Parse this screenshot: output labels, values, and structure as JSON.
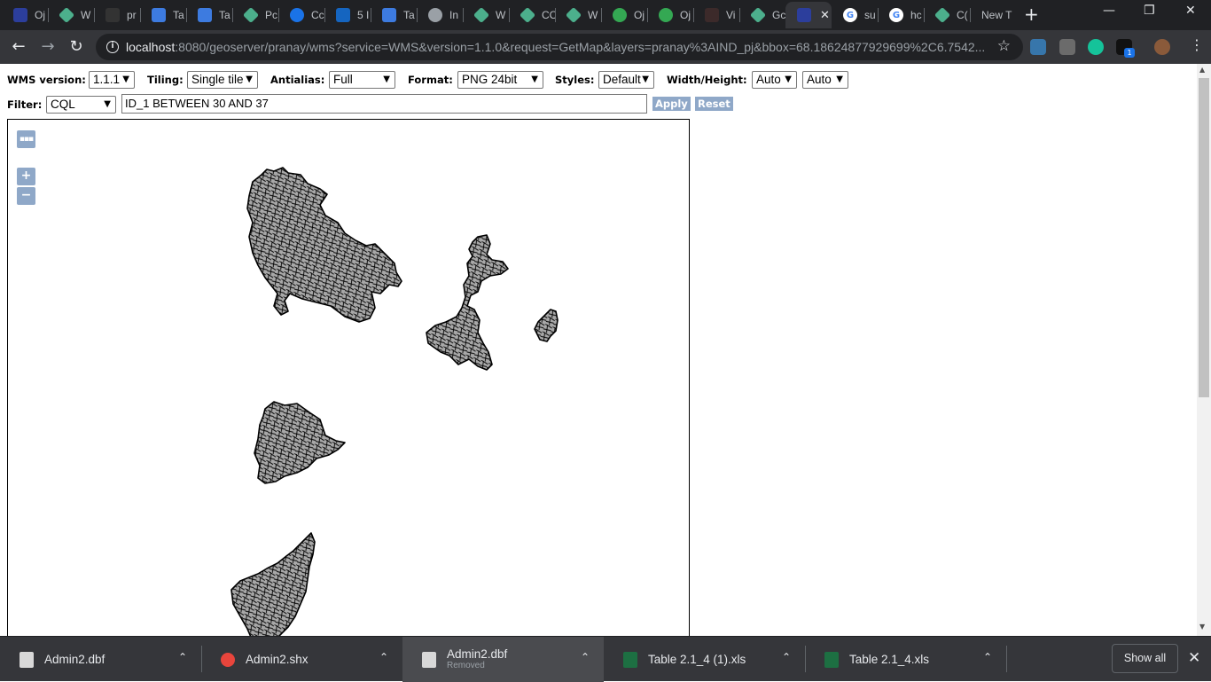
{
  "browser": {
    "tabs": [
      {
        "title": "Oj",
        "icon": "geoserver-bluepink-icon",
        "color": "#2c3e9c"
      },
      {
        "title": "W",
        "icon": "diamond-icon",
        "color": "#4caf8c"
      },
      {
        "title": "pr",
        "icon": "github-icon",
        "color": "#333333"
      },
      {
        "title": "Ta",
        "icon": "gear-blue-icon",
        "color": "#3d7be0"
      },
      {
        "title": "Ta",
        "icon": "gear-blue-icon",
        "color": "#3d7be0"
      },
      {
        "title": "Pc",
        "icon": "diamond-icon",
        "color": "#4caf8c"
      },
      {
        "title": "Cc",
        "icon": "circle-logo-icon",
        "color": "#1a73e8"
      },
      {
        "title": "5 I",
        "icon": "dot-icon",
        "color": "#1565c0"
      },
      {
        "title": "Ta",
        "icon": "gear-blue-icon",
        "color": "#3d7be0"
      },
      {
        "title": "In",
        "icon": "globe-icon",
        "color": "#9aa0a6"
      },
      {
        "title": "W",
        "icon": "diamond-icon",
        "color": "#4caf8c"
      },
      {
        "title": "CC",
        "icon": "diamond-icon",
        "color": "#4caf8c"
      },
      {
        "title": "W",
        "icon": "diamond-icon",
        "color": "#4caf8c"
      },
      {
        "title": "Oj",
        "icon": "spinner-icon",
        "color": "#34a853"
      },
      {
        "title": "Oj",
        "icon": "spinner-icon",
        "color": "#34a853"
      },
      {
        "title": "Vi",
        "icon": "dark-square-icon",
        "color": "#3c2a2a"
      },
      {
        "title": "Gc",
        "icon": "diamond-icon",
        "color": "#4caf8c"
      },
      {
        "title": "",
        "icon": "geoserver-bluepink-icon",
        "color": "#2c3e9c",
        "active": true
      },
      {
        "title": "su",
        "icon": "google-icon",
        "color": "#ffffff"
      },
      {
        "title": "hc",
        "icon": "google-icon",
        "color": "#ffffff"
      },
      {
        "title": "C(",
        "icon": "diamond-icon",
        "color": "#4caf8c"
      },
      {
        "title": "New T",
        "icon": "none",
        "color": "#202124"
      }
    ],
    "url_host": "localhost",
    "url_rest": ":8080/geoserver/pranay/wms?service=WMS&version=1.1.0&request=GetMap&layers=pranay%3AIND_pj&bbox=68.18624877929699%2C6.7542..."
  },
  "controls": {
    "wms_version_label": "WMS version:",
    "wms_version_value": "1.1.1",
    "tiling_label": "Tiling:",
    "tiling_value": "Single tile",
    "antialias_label": "Antialias:",
    "antialias_value": "Full",
    "format_label": "Format:",
    "format_value": "PNG 24bit",
    "styles_label": "Styles:",
    "styles_value": "Default",
    "wh_label": "Width/Height:",
    "width_value": "Auto",
    "height_value": "Auto",
    "filter_label": "Filter:",
    "filter_type": "CQL",
    "filter_expression": "ID_1 BETWEEN 30 AND 37",
    "apply_label": "Apply",
    "reset_label": "Reset"
  },
  "map": {
    "more_label": "▪▪▪",
    "zoom_in": "+",
    "zoom_out": "−",
    "fill_color": "#a8a8a8",
    "stroke_color": "#000000"
  },
  "downloads": [
    {
      "name": "Admin2.dbf",
      "sub": "",
      "icon": "file-icon"
    },
    {
      "name": "Admin2.shx",
      "sub": "",
      "icon": "chrome-icon"
    },
    {
      "name": "Admin2.dbf",
      "sub": "Removed",
      "icon": "file-icon"
    },
    {
      "name": "Table 2.1_4 (1).xls",
      "sub": "",
      "icon": "excel-icon"
    },
    {
      "name": "Table 2.1_4.xls",
      "sub": "",
      "icon": "excel-icon"
    }
  ],
  "show_all_label": "Show all"
}
